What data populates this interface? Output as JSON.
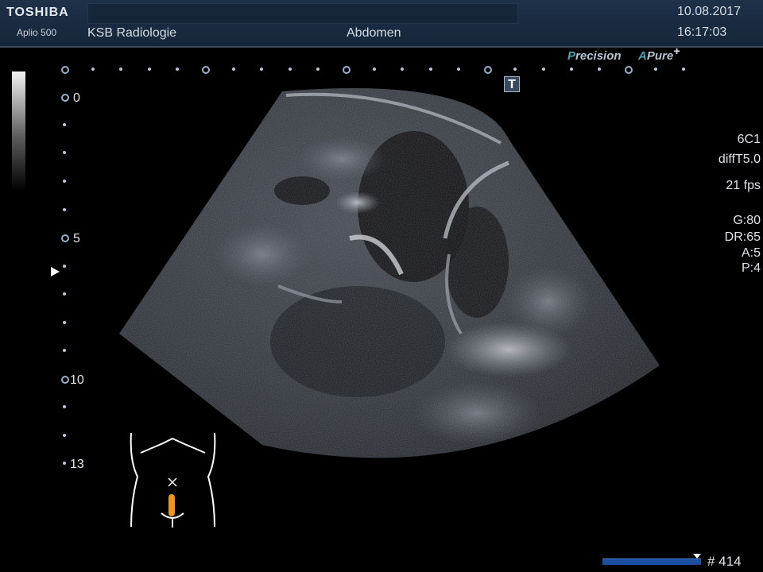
{
  "header": {
    "brand": "TOSHIBA",
    "model": "Aplio 500",
    "institution": "KSB Radiologie",
    "preset": "Abdomen",
    "date": "10.08.2017",
    "time": "16:17:03"
  },
  "logos": {
    "precision_p": "P",
    "precision_rest": "recision",
    "apure_a": "A",
    "apure_pure": "Pure",
    "apure_plus": "+"
  },
  "t_icon_label": "T",
  "depth_scale": {
    "labels": [
      "0",
      "5",
      "10",
      "13"
    ]
  },
  "params": {
    "transducer": "6C1",
    "mode": "diffT5.0",
    "frame_rate": "21 fps",
    "gain": "G:80",
    "dynamic_range": "DR:65",
    "a": "A:5",
    "p": "P:4"
  },
  "cine": {
    "frame_label": "# 414"
  },
  "colors": {
    "header_bg": "#1e3149",
    "accent_teal": "#4aa8b4",
    "probe_marker": "#f0961e",
    "cine_bar": "#1a4fa0"
  }
}
